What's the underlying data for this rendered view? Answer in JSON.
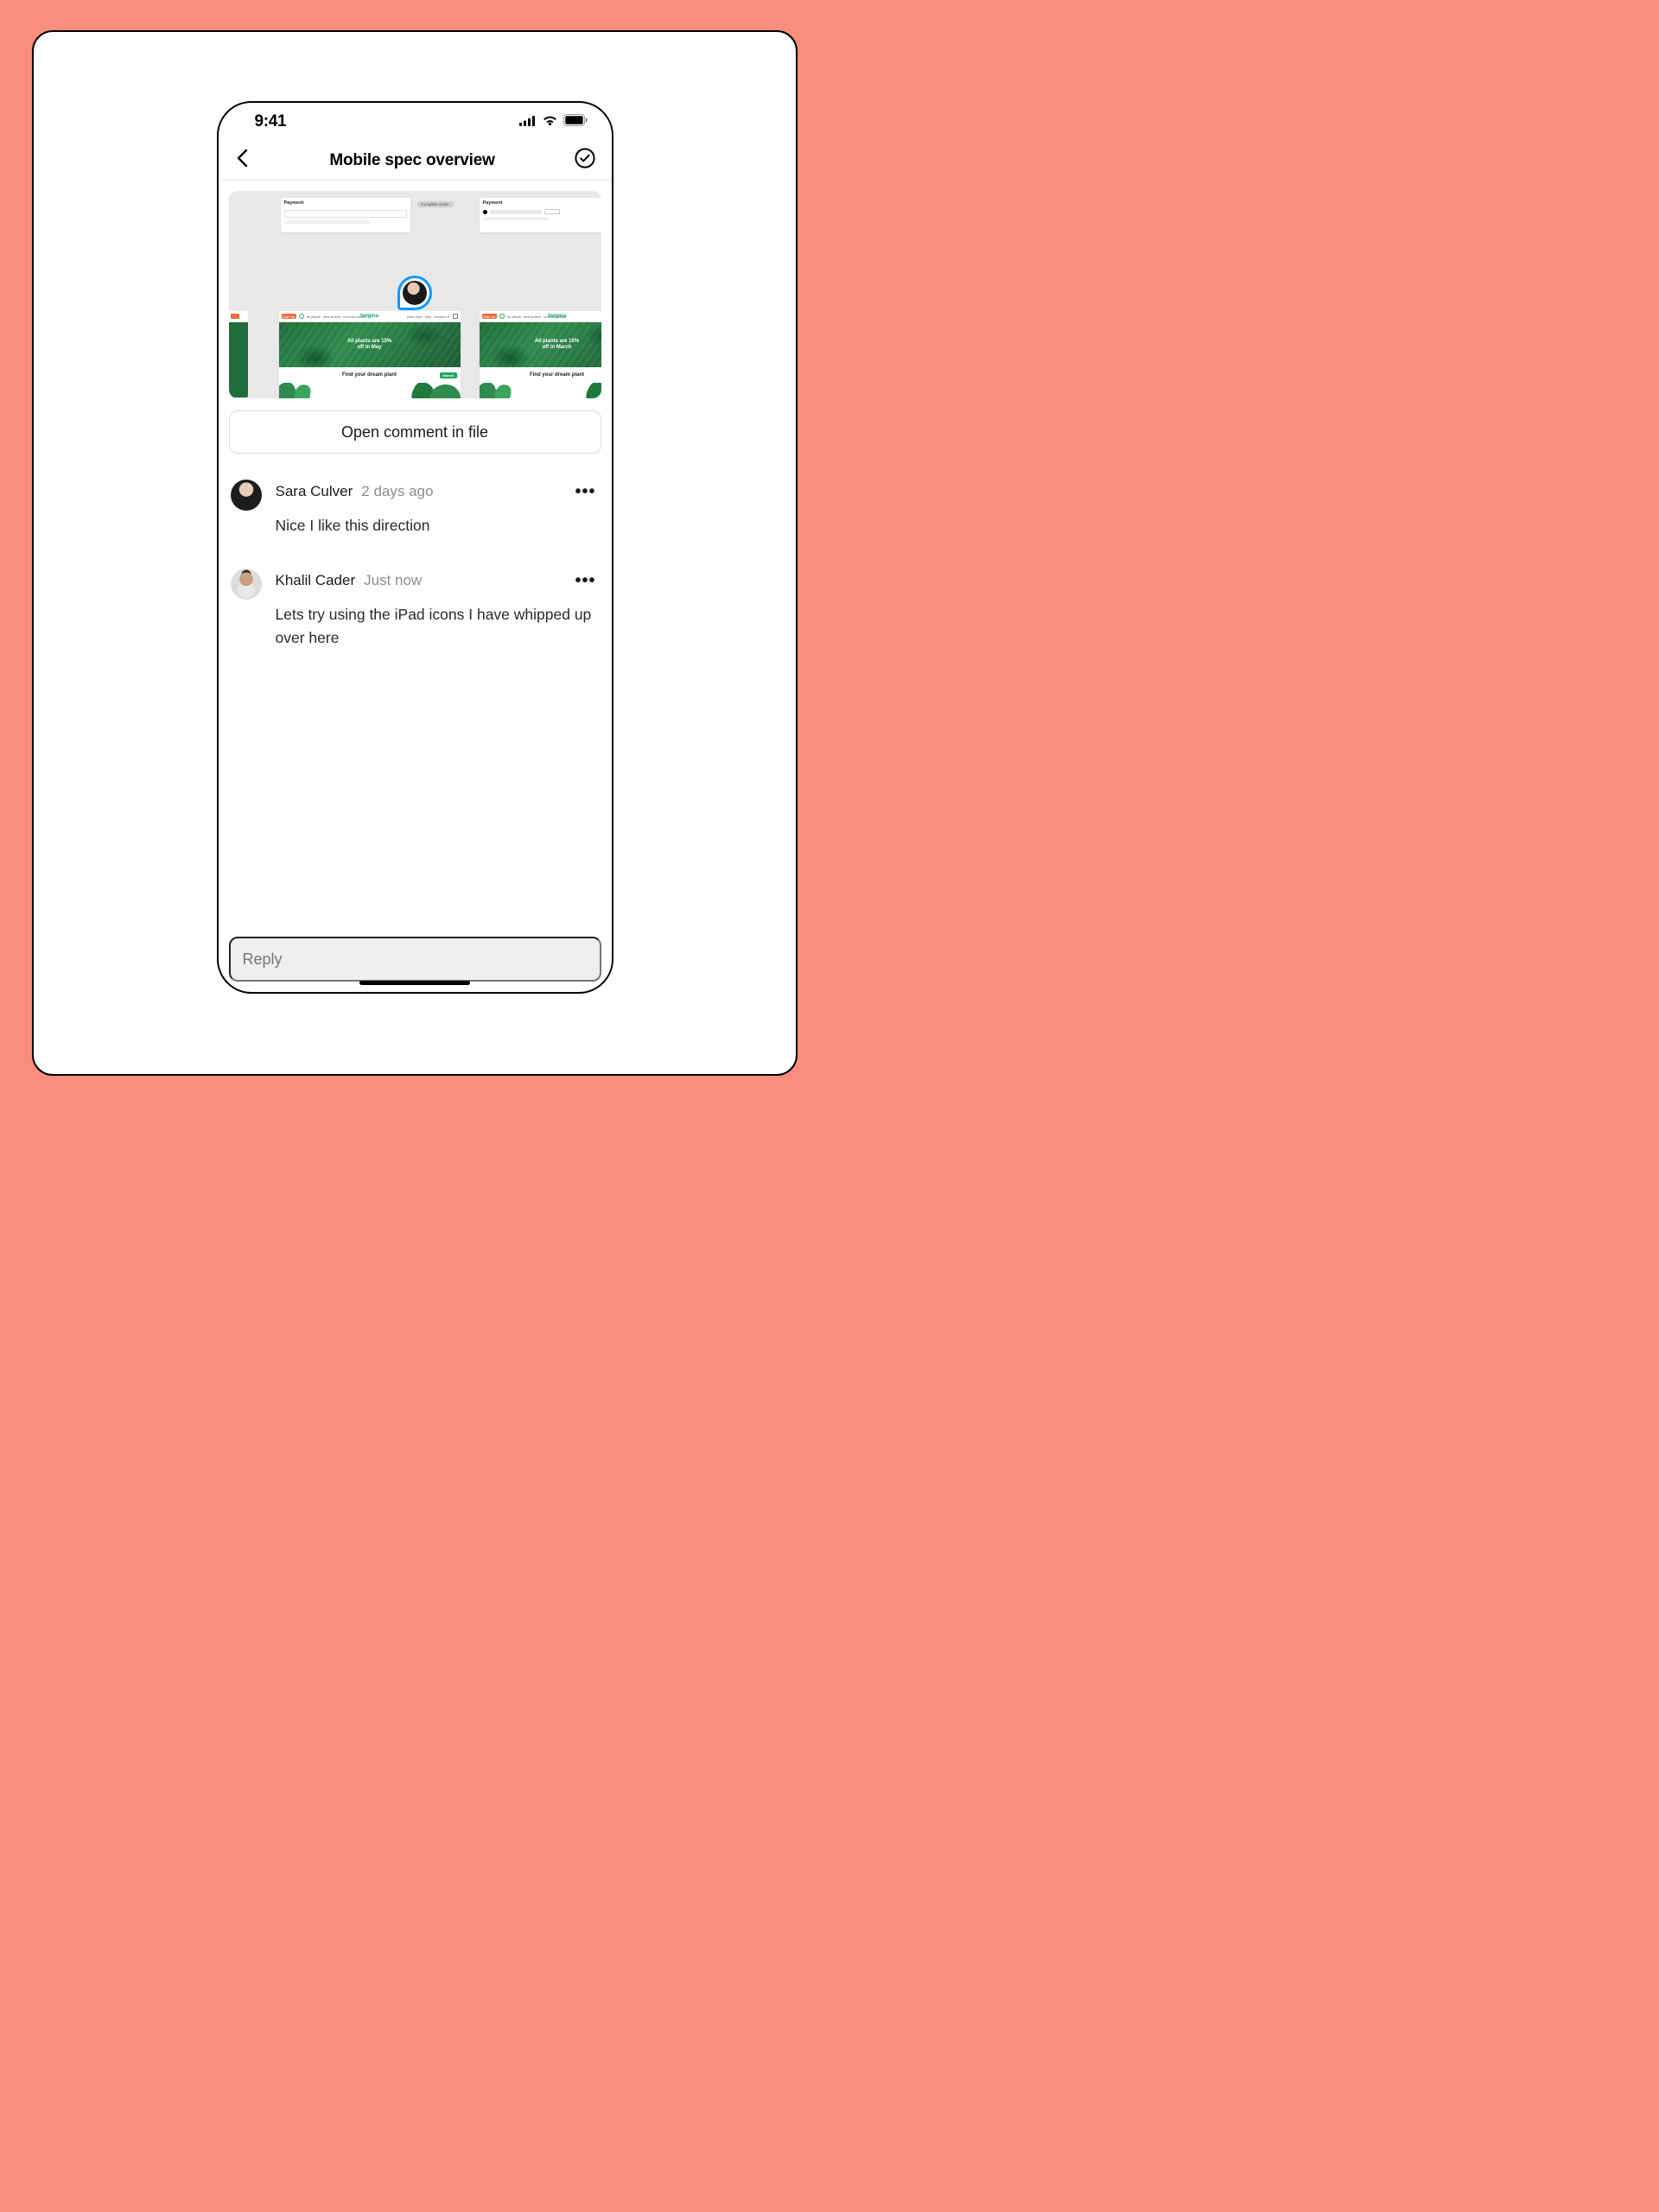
{
  "status": {
    "time": "9:41"
  },
  "nav": {
    "title": "Mobile spec overview"
  },
  "preview": {
    "payment_label": "Payment",
    "complete_label": "Complete Order",
    "brand": "twigma",
    "hero_a": "All plants are 15%\noff in May",
    "hero_b": "All plants are 15%\noff in March",
    "find": "Find your dream plant"
  },
  "actions": {
    "open_in_file": "Open comment in file"
  },
  "comments": [
    {
      "author": "Sara Culver",
      "time": "2 days ago",
      "text": "Nice I like this direction"
    },
    {
      "author": "Khalil Cader",
      "time": "Just now",
      "text": "Lets try using the iPad icons I have whipped up over here"
    }
  ],
  "reply": {
    "placeholder": "Reply"
  }
}
